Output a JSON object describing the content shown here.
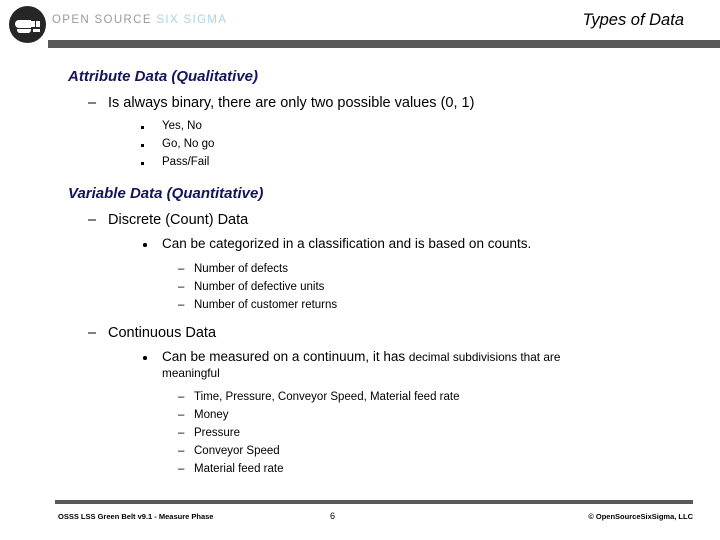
{
  "header": {
    "brand_primary": "OPEN SOURCE ",
    "brand_secondary": "SIX SIGMA",
    "logo_icon": "osss-circle-logo-icon",
    "title": "Types of Data",
    "bar_color": "#595959",
    "brand_primary_color": "#9a9a9a",
    "brand_secondary_color": "#a9d3e8"
  },
  "content": {
    "heading_color": "#14145a",
    "section1": {
      "heading": "Attribute Data (Qualitative)",
      "point": "Is always binary, there are only two possible values (0, 1)",
      "subpoints": [
        "Yes, No",
        "Go, No go",
        "Pass/Fail"
      ]
    },
    "section2": {
      "heading": "Variable Data (Quantitative)",
      "discrete": {
        "label": "Discrete (Count) Data",
        "detail": "Can be categorized in a classification and is based on counts.",
        "examples": [
          "Number of defects",
          "Number of defective units",
          "Number of customer returns"
        ]
      },
      "continuous": {
        "label": "Continuous Data",
        "detail_main": "Can be measured on a continuum, it has ",
        "detail_small": "decimal subdivisions that are",
        "detail_wrap": "meaningful",
        "examples": [
          "Time, Pressure, Conveyor Speed, Material feed rate",
          "Money",
          "Pressure",
          "Conveyor Speed",
          "Material feed rate"
        ]
      }
    }
  },
  "footer": {
    "left": "OSSS LSS Green Belt v9.1 - Measure Phase",
    "page_number": "6",
    "right": "© OpenSourceSixSigma, LLC",
    "bar_color": "#595959"
  }
}
